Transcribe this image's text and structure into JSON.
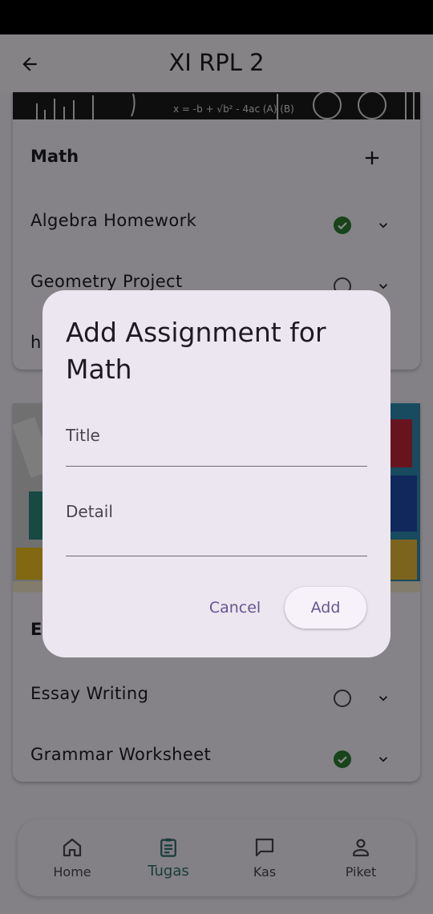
{
  "app_bar": {
    "title": "XI RPL 2",
    "back_icon": "arrow-back-icon"
  },
  "cards": [
    {
      "subject": "Math",
      "banner_text": "x = -b + √b² - 4ac  (A) (B)",
      "tasks": [
        {
          "title": "Algebra Homework",
          "done": true
        },
        {
          "title": "Geometry Project",
          "done": false
        },
        {
          "title": "h",
          "done": false
        }
      ]
    },
    {
      "subject": "E",
      "tasks": [
        {
          "title": "Essay Writing",
          "done": false
        },
        {
          "title": "Grammar Worksheet",
          "done": true
        }
      ]
    }
  ],
  "dialog": {
    "title": "Add Assignment for Math",
    "title_placeholder": "Title",
    "detail_placeholder": "Detail",
    "cancel_label": "Cancel",
    "add_label": "Add"
  },
  "bottom_nav": {
    "items": [
      {
        "label": "Home",
        "icon": "home-icon",
        "active": false
      },
      {
        "label": "Tugas",
        "icon": "clipboard-icon",
        "active": true
      },
      {
        "label": "Kas",
        "icon": "chat-icon",
        "active": false
      },
      {
        "label": "Piket",
        "icon": "person-icon",
        "active": false
      }
    ]
  },
  "colors": {
    "accent": "#65558f",
    "done_green": "#2e7d32",
    "nav_active": "#2f6f6a",
    "dialog_bg": "#ece6f0"
  }
}
